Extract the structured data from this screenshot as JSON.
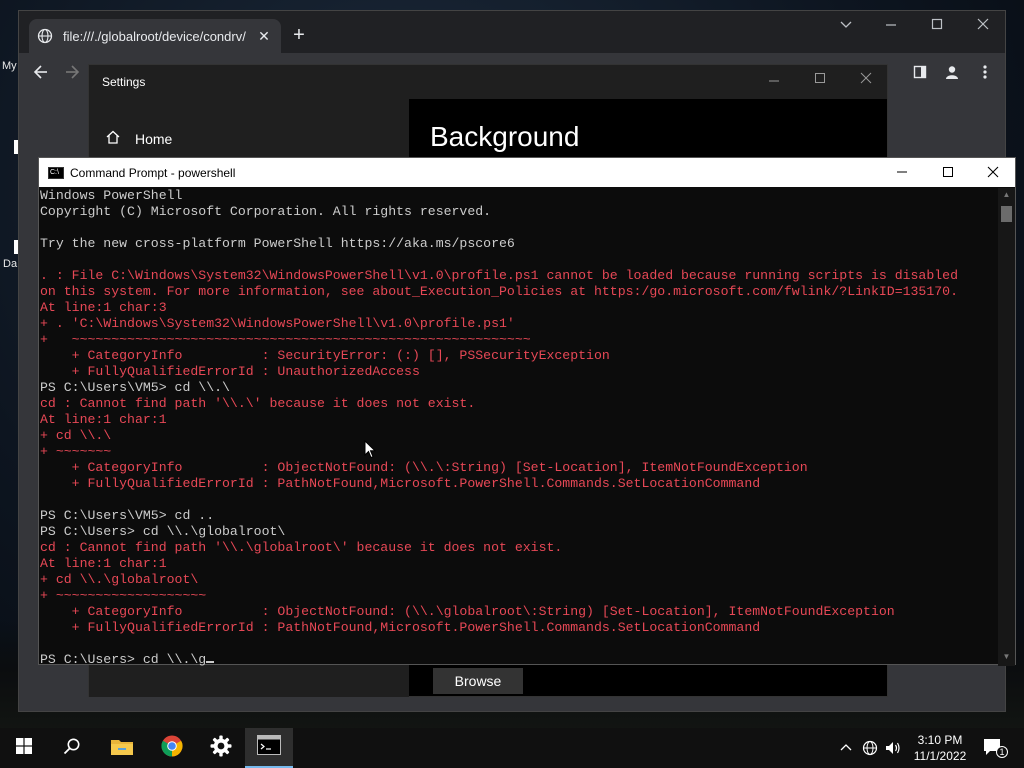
{
  "desktop": {
    "label1": "My",
    "label2": "Da"
  },
  "chrome": {
    "tab_title": "file:///./globalroot/device/condrv/",
    "tab_close": "✕",
    "new_tab": "+",
    "url_partial": "Settings"
  },
  "settings": {
    "window_title": "Settings",
    "home_label": "Home",
    "page_title": "Background",
    "browse_label": "Browse"
  },
  "console": {
    "window_title": "Command Prompt - powershell",
    "lines": [
      {
        "text": "Windows PowerShell",
        "kind": "out"
      },
      {
        "text": "Copyright (C) Microsoft Corporation. All rights reserved.",
        "kind": "out"
      },
      {
        "text": "",
        "kind": "out"
      },
      {
        "text": "Try the new cross-platform PowerShell https://aka.ms/pscore6",
        "kind": "out"
      },
      {
        "text": "",
        "kind": "out"
      },
      {
        "text": ". : File C:\\Windows\\System32\\WindowsPowerShell\\v1.0\\profile.ps1 cannot be loaded because running scripts is disabled",
        "kind": "err"
      },
      {
        "text": "on this system. For more information, see about_Execution_Policies at https:/go.microsoft.com/fwlink/?LinkID=135170.",
        "kind": "err"
      },
      {
        "text": "At line:1 char:3",
        "kind": "err"
      },
      {
        "text": "+ . 'C:\\Windows\\System32\\WindowsPowerShell\\v1.0\\profile.ps1'",
        "kind": "err"
      },
      {
        "text": "+   ~~~~~~~~~~~~~~~~~~~~~~~~~~~~~~~~~~~~~~~~~~~~~~~~~~~~~~~~~~",
        "kind": "err"
      },
      {
        "text": "    + CategoryInfo          : SecurityError: (:) [], PSSecurityException",
        "kind": "err"
      },
      {
        "text": "    + FullyQualifiedErrorId : UnauthorizedAccess",
        "kind": "err"
      },
      {
        "text": "PS C:\\Users\\VM5> cd \\\\.\\",
        "kind": "out"
      },
      {
        "text": "cd : Cannot find path '\\\\.\\' because it does not exist.",
        "kind": "err"
      },
      {
        "text": "At line:1 char:1",
        "kind": "err"
      },
      {
        "text": "+ cd \\\\.\\",
        "kind": "err"
      },
      {
        "text": "+ ~~~~~~~",
        "kind": "err"
      },
      {
        "text": "    + CategoryInfo          : ObjectNotFound: (\\\\.\\:String) [Set-Location], ItemNotFoundException",
        "kind": "err"
      },
      {
        "text": "    + FullyQualifiedErrorId : PathNotFound,Microsoft.PowerShell.Commands.SetLocationCommand",
        "kind": "err"
      },
      {
        "text": "",
        "kind": "out"
      },
      {
        "text": "PS C:\\Users\\VM5> cd ..",
        "kind": "out"
      },
      {
        "text": "PS C:\\Users> cd \\\\.\\globalroot\\",
        "kind": "out"
      },
      {
        "text": "cd : Cannot find path '\\\\.\\globalroot\\' because it does not exist.",
        "kind": "err"
      },
      {
        "text": "At line:1 char:1",
        "kind": "err"
      },
      {
        "text": "+ cd \\\\.\\globalroot\\",
        "kind": "err"
      },
      {
        "text": "+ ~~~~~~~~~~~~~~~~~~~",
        "kind": "err"
      },
      {
        "text": "    + CategoryInfo          : ObjectNotFound: (\\\\.\\globalroot\\:String) [Set-Location], ItemNotFoundException",
        "kind": "err"
      },
      {
        "text": "    + FullyQualifiedErrorId : PathNotFound,Microsoft.PowerShell.Commands.SetLocationCommand",
        "kind": "err"
      },
      {
        "text": "",
        "kind": "out"
      },
      {
        "text": "PS C:\\Users> cd \\\\.\\g",
        "kind": "prompt"
      }
    ]
  },
  "taskbar": {
    "time": "3:10 PM",
    "date": "11/1/2022",
    "notification_count": "1"
  }
}
